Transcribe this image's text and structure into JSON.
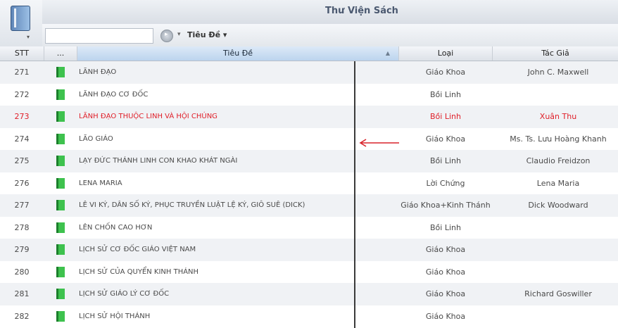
{
  "window": {
    "title": "Thư Viện Sách"
  },
  "toolbar": {
    "search_value": "",
    "field_select": "Tiêu Đề ▾"
  },
  "columns": {
    "stt": "STT",
    "more": "...",
    "title": "Tiêu Đề",
    "type": "Loại",
    "author": "Tác Giả"
  },
  "colors": {
    "highlight": "#e0202a",
    "book_icon": "#3ec24e",
    "header_selected": "#bcd4ee"
  },
  "rows": [
    {
      "stt": "271",
      "title": "LÃNH ĐẠO",
      "type": "Giáo Khoa",
      "author": "John C. Maxwell"
    },
    {
      "stt": "272",
      "title": "LÃNH ĐẠO CƠ ĐỐC",
      "type": "Bồi Linh",
      "author": ""
    },
    {
      "stt": "273",
      "title": "LÃNH ĐẠO THUỘC LINH VÀ HỘI CHÚNG",
      "type": "Bồi Linh",
      "author": "Xuân Thu"
    },
    {
      "stt": "274",
      "title": "LÃO GIÁO",
      "type": "Giáo Khoa",
      "author": "Ms. Ts. Lưu Hoàng Khanh"
    },
    {
      "stt": "275",
      "title": "LẠY ĐỨC THÁNH LINH CON KHAO KHÁT NGÀI",
      "type": "Bồi Linh",
      "author": "Claudio Freidzon"
    },
    {
      "stt": "276",
      "title": "LENA MARIA",
      "type": "Lời Chứng",
      "author": "Lena Maria"
    },
    {
      "stt": "277",
      "title": "LÊ VI KÝ, DÂN SỐ KÝ, PHỤC TRUYỀN LUẬT LỆ KÝ, GIÔ SUÊ (DICK)",
      "type": "Giáo Khoa+Kinh Thánh",
      "author": "Dick Woodward"
    },
    {
      "stt": "278",
      "title": "LÊN CHỐN CAO HƠN",
      "type": "Bồi Linh",
      "author": ""
    },
    {
      "stt": "279",
      "title": "LỊCH SỬ CƠ ĐỐC GIÁO VIỆT NAM",
      "type": "Giáo Khoa",
      "author": ""
    },
    {
      "stt": "280",
      "title": "LỊCH SỬ CỦA QUYỂN KINH THÁNH",
      "type": "Giáo Khoa",
      "author": ""
    },
    {
      "stt": "281",
      "title": "LỊCH SỬ GIÁO LÝ CƠ ĐỐC",
      "type": "Giáo Khoa",
      "author": "Richard Goswiller"
    },
    {
      "stt": "282",
      "title": "LỊCH SỬ HỘI THÁNH",
      "type": "Giáo Khoa",
      "author": ""
    }
  ]
}
